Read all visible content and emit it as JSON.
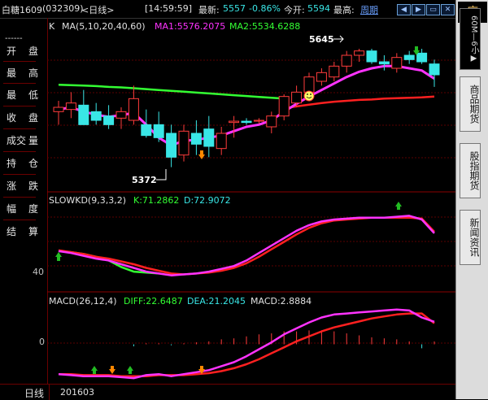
{
  "header": {
    "symbol": "白糖1609",
    "code": "(032309)",
    "period_label": "<日线>",
    "time": "[14:59:59]",
    "latest_label": "最新:",
    "latest_value": "5557",
    "change": "-0.86%",
    "open_label": "今开:",
    "open_value": "5594",
    "high_label": "最高:",
    "cycle_button": "周期",
    "buttons": [
      "prev",
      "next",
      "restore",
      "close"
    ]
  },
  "left_panel": {
    "rows": [
      {
        "a": "开",
        "b": "盘"
      },
      {
        "a": "最",
        "b": "高"
      },
      {
        "a": "最",
        "b": "低"
      },
      {
        "a": "收",
        "b": "盘"
      },
      {
        "a": "成交",
        "b": "量"
      },
      {
        "a": "持",
        "b": "仓"
      },
      {
        "a": "涨",
        "b": "跌"
      },
      {
        "a": "幅",
        "b": "度"
      },
      {
        "a": "结",
        "b": "算"
      }
    ],
    "dashes": "------"
  },
  "main_panel": {
    "k_label": "K",
    "ma_label": "MA(5,10,20,40,60)",
    "ma1_label": "MA1:5576.2075",
    "ma2_label": "MA2:5534.6288",
    "high_annotation": "5645",
    "low_annotation": "5372"
  },
  "kd_panel": {
    "label": "SLOWKD(9,3,3,2)",
    "k_label": "K:71.2862",
    "d_label": "D:72.9072",
    "tick": "40"
  },
  "macd_panel": {
    "label": "MACD(26,12,4)",
    "diff_label": "DIFF:22.6487",
    "dea_label": "DEA:21.2045",
    "macd_label": "MACD:2.8884",
    "tick": "0"
  },
  "bottom_bar": {
    "period": "日线",
    "date": "201603"
  },
  "right_tabs": [
    {
      "label": "序"
    },
    {
      "label": "60M—6小▶"
    },
    {
      "label": "商品期货"
    },
    {
      "label": "股指期货"
    },
    {
      "label": "新闻资讯"
    }
  ],
  "colors": {
    "up": "#ff3b3b",
    "down": "#39e6e6",
    "ma1": "#ff33ff",
    "ma2": "#ff2020",
    "ma3": "#33ff33",
    "k_line": "#ff33ff",
    "d_line": "#ff2020",
    "diff_line": "#ff33ff",
    "dea_line": "#ff2020",
    "neg_line": "#33ff33"
  },
  "chart_data": {
    "type": "candlestick",
    "candles": [
      {
        "o": 5500,
        "h": 5525,
        "l": 5470,
        "c": 5510
      },
      {
        "o": 5505,
        "h": 5545,
        "l": 5485,
        "c": 5520
      },
      {
        "o": 5515,
        "h": 5550,
        "l": 5480,
        "c": 5470
      },
      {
        "o": 5500,
        "h": 5520,
        "l": 5470,
        "c": 5480
      },
      {
        "o": 5490,
        "h": 5515,
        "l": 5460,
        "c": 5470
      },
      {
        "o": 5485,
        "h": 5510,
        "l": 5460,
        "c": 5500
      },
      {
        "o": 5480,
        "h": 5560,
        "l": 5470,
        "c": 5530
      },
      {
        "o": 5470,
        "h": 5505,
        "l": 5440,
        "c": 5445
      },
      {
        "o": 5470,
        "h": 5500,
        "l": 5430,
        "c": 5440
      },
      {
        "o": 5450,
        "h": 5470,
        "l": 5372,
        "c": 5395
      },
      {
        "o": 5400,
        "h": 5470,
        "l": 5385,
        "c": 5455
      },
      {
        "o": 5450,
        "h": 5480,
        "l": 5400,
        "c": 5425
      },
      {
        "o": 5460,
        "h": 5490,
        "l": 5395,
        "c": 5420
      },
      {
        "o": 5415,
        "h": 5465,
        "l": 5400,
        "c": 5450
      },
      {
        "o": 5475,
        "h": 5490,
        "l": 5440,
        "c": 5478
      },
      {
        "o": 5478,
        "h": 5485,
        "l": 5470,
        "c": 5475
      },
      {
        "o": 5478,
        "h": 5485,
        "l": 5472,
        "c": 5480
      },
      {
        "o": 5465,
        "h": 5500,
        "l": 5450,
        "c": 5490
      },
      {
        "o": 5490,
        "h": 5540,
        "l": 5480,
        "c": 5535
      },
      {
        "o": 5520,
        "h": 5560,
        "l": 5510,
        "c": 5545
      },
      {
        "o": 5545,
        "h": 5590,
        "l": 5535,
        "c": 5580
      },
      {
        "o": 5570,
        "h": 5600,
        "l": 5560,
        "c": 5590
      },
      {
        "o": 5580,
        "h": 5615,
        "l": 5570,
        "c": 5605
      },
      {
        "o": 5605,
        "h": 5640,
        "l": 5590,
        "c": 5630
      },
      {
        "o": 5630,
        "h": 5645,
        "l": 5615,
        "c": 5640
      },
      {
        "o": 5640,
        "h": 5645,
        "l": 5610,
        "c": 5615
      },
      {
        "o": 5615,
        "h": 5630,
        "l": 5595,
        "c": 5610
      },
      {
        "o": 5600,
        "h": 5635,
        "l": 5590,
        "c": 5625
      },
      {
        "o": 5630,
        "h": 5640,
        "l": 5610,
        "c": 5620
      },
      {
        "o": 5635,
        "h": 5645,
        "l": 5610,
        "c": 5615
      },
      {
        "o": 5610,
        "h": 5620,
        "l": 5557,
        "c": 5585
      }
    ],
    "ma1": [
      5505,
      5510,
      5500,
      5493,
      5488,
      5492,
      5497,
      5470,
      5440,
      5422,
      5433,
      5435,
      5440,
      5445,
      5455,
      5465,
      5470,
      5480,
      5500,
      5518,
      5535,
      5550,
      5565,
      5580,
      5592,
      5600,
      5605,
      5605,
      5600,
      5595,
      5576
    ],
    "ma2": [
      null,
      null,
      null,
      null,
      null,
      null,
      null,
      null,
      null,
      null,
      null,
      null,
      null,
      null,
      null,
      null,
      null,
      null,
      5508,
      5512,
      5516,
      5520,
      5523,
      5525,
      5527,
      5528,
      5530,
      5531,
      5532,
      5533,
      5535
    ],
    "ma3": [
      5562,
      5561,
      5560,
      5559,
      5557,
      5556,
      5554,
      5552,
      5550,
      5548,
      5546,
      5544,
      5542,
      5540,
      5538,
      5536,
      5534,
      5532,
      5530,
      null,
      null,
      null,
      null,
      null,
      null,
      null,
      null,
      null,
      null,
      null,
      null
    ],
    "kd_k": [
      52,
      50,
      47,
      44,
      42,
      38,
      34,
      30,
      28,
      26,
      27,
      28,
      30,
      33,
      36,
      42,
      50,
      58,
      66,
      74,
      80,
      84,
      86,
      87,
      88,
      88,
      88,
      89,
      90,
      86,
      71.2862
    ],
    "kd_d": [
      53,
      51,
      49,
      46,
      44,
      41,
      38,
      34,
      31,
      28,
      27,
      28,
      29,
      31,
      34,
      39,
      46,
      54,
      62,
      70,
      77,
      82,
      85,
      86,
      87,
      88,
      88,
      88,
      88,
      87,
      72.9072
    ],
    "kd_green": [
      52,
      51,
      49,
      46,
      42,
      35,
      30,
      29,
      28
    ],
    "diff": [
      -30,
      -31,
      -32,
      -32,
      -32,
      -33,
      -34,
      -31,
      -30,
      -32,
      -30,
      -28,
      -26,
      -22,
      -18,
      -12,
      -5,
      2,
      10,
      16,
      22,
      27,
      30,
      31,
      32,
      33,
      34,
      35,
      34,
      27,
      22.6487
    ],
    "dea": [
      -30,
      -30,
      -31,
      -31,
      -31,
      -32,
      -32,
      -32,
      -31,
      -31,
      -31,
      -30,
      -29,
      -27,
      -24,
      -20,
      -15,
      -9,
      -3,
      3,
      8,
      13,
      17,
      20,
      23,
      26,
      28,
      30,
      31,
      31,
      21.2045
    ],
    "macd_bars": [
      0,
      0,
      0,
      0,
      0,
      0,
      -2,
      1,
      1,
      -1,
      1,
      2,
      3,
      5,
      6,
      8,
      10,
      11,
      13,
      13,
      14,
      14,
      13,
      11,
      9,
      7,
      6,
      5,
      3,
      -4,
      2.8884
    ],
    "kd_ylim": [
      10,
      100
    ],
    "macd_ylim": [
      -38,
      38
    ]
  }
}
